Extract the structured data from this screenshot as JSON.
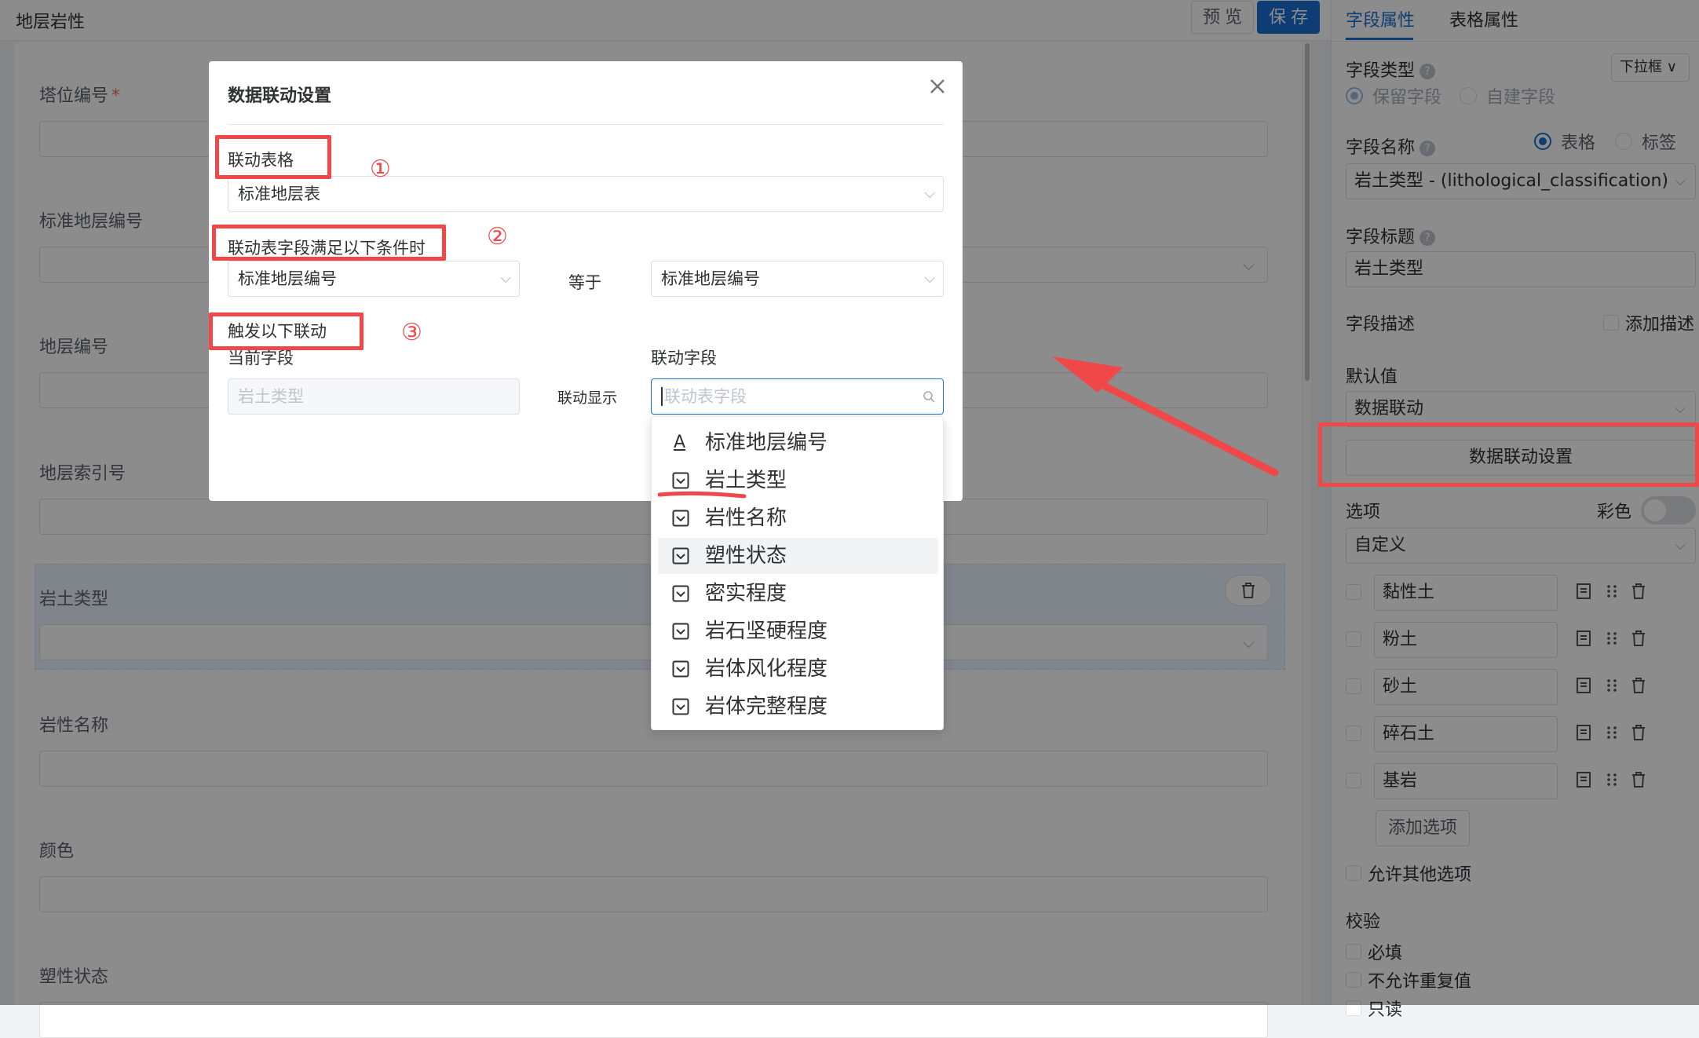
{
  "header": {
    "page_title": "地层岩性",
    "preview_label": "预 览",
    "save_label": "保 存"
  },
  "form": {
    "fields": [
      {
        "label": "塔位编号",
        "required": true
      },
      {
        "label": "标准地层编号"
      },
      {
        "label": "地层编号"
      },
      {
        "label": "地层索引号"
      },
      {
        "label": "岩土类型"
      },
      {
        "label": "岩性名称"
      },
      {
        "label": "颜色"
      },
      {
        "label": "塑性状态"
      }
    ],
    "required_mark": "*"
  },
  "panel": {
    "tabs": [
      "字段属性",
      "表格属性"
    ],
    "field_type_label": "字段类型",
    "field_type_value": "下拉框",
    "field_kind_options": [
      "保留字段",
      "自建字段"
    ],
    "field_name_label": "字段名称",
    "field_name_sources": [
      "表格",
      "标签"
    ],
    "field_name_value": "岩土类型 - (lithological_classification)",
    "field_title_label": "字段标题",
    "field_title_value": "岩土类型",
    "field_desc_label": "字段描述",
    "add_desc_label": "添加描述",
    "default_label": "默认值",
    "default_value": "数据联动",
    "linkage_button": "数据联动设置",
    "options_label": "选项",
    "color_label": "彩色",
    "options_source": "自定义",
    "options": [
      "黏性土",
      "粉土",
      "砂土",
      "碎石土",
      "基岩"
    ],
    "add_option": "添加选项",
    "allow_other": "允许其他选项",
    "validation_label": "校验",
    "validations": [
      "必填",
      "不允许重复值",
      "只读"
    ]
  },
  "dialog": {
    "title": "数据联动设置",
    "section1_label": "联动表格",
    "table_value": "标准地层表",
    "section2_label": "联动表字段满足以下条件时",
    "cond_left": "标准地层编号",
    "cond_op": "等于",
    "cond_right": "标准地层编号",
    "section3_label": "触发以下联动",
    "current_field_label": "当前字段",
    "linked_field_label": "联动字段",
    "current_field_value": "岩土类型",
    "link_display": "联动显示",
    "search_placeholder": "联动表字段",
    "markers": [
      "①",
      "②",
      "③"
    ]
  },
  "dropdown": {
    "items": [
      {
        "label": "标准地层编号",
        "icon": "text-icon"
      },
      {
        "label": "岩土类型",
        "icon": "select-icon"
      },
      {
        "label": "岩性名称",
        "icon": "select-icon"
      },
      {
        "label": "塑性状态",
        "icon": "select-icon"
      },
      {
        "label": "密实程度",
        "icon": "select-icon"
      },
      {
        "label": "岩石坚硬程度",
        "icon": "select-icon"
      },
      {
        "label": "岩体风化程度",
        "icon": "select-icon"
      },
      {
        "label": "岩体完整程度",
        "icon": "select-icon"
      }
    ],
    "text_icon_glyph": "A",
    "hovered_index": 3
  },
  "colors": {
    "accent": "#1a6fd8",
    "annotation": "#f04848"
  }
}
